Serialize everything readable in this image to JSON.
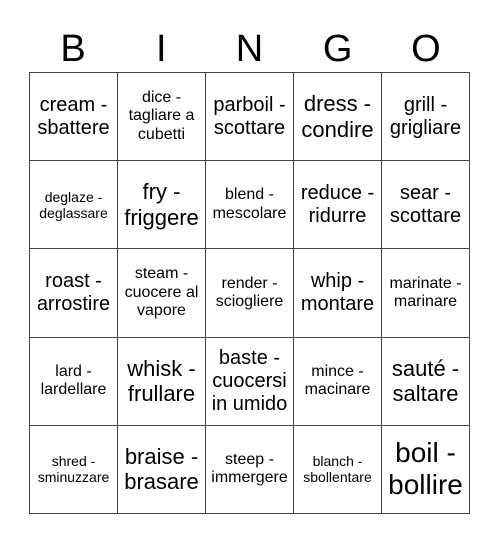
{
  "header": {
    "letters": [
      "B",
      "I",
      "N",
      "G",
      "O"
    ]
  },
  "grid": {
    "rows": [
      [
        {
          "text": "cream - sbattere",
          "size": "lg"
        },
        {
          "text": "dice - tagliare a cubetti",
          "size": "md"
        },
        {
          "text": "parboil - scottare",
          "size": "lg"
        },
        {
          "text": "dress - condire",
          "size": "xl"
        },
        {
          "text": "grill - grigliare",
          "size": "lg"
        }
      ],
      [
        {
          "text": "deglaze - deglassare",
          "size": "sm"
        },
        {
          "text": "fry - friggere",
          "size": "xl"
        },
        {
          "text": "blend - mescolare",
          "size": "md"
        },
        {
          "text": "reduce - ridurre",
          "size": "lg"
        },
        {
          "text": "sear - scottare",
          "size": "lg"
        }
      ],
      [
        {
          "text": "roast - arrostire",
          "size": "lg"
        },
        {
          "text": "steam - cuocere al vapore",
          "size": "md"
        },
        {
          "text": "render - sciogliere",
          "size": "md"
        },
        {
          "text": "whip - montare",
          "size": "lg"
        },
        {
          "text": "marinate - marinare",
          "size": "md"
        }
      ],
      [
        {
          "text": "lard - lardellare",
          "size": "md"
        },
        {
          "text": "whisk - frullare",
          "size": "xl"
        },
        {
          "text": "baste - cuocersi in umido",
          "size": "lg"
        },
        {
          "text": "mince - macinare",
          "size": "md"
        },
        {
          "text": "sauté - saltare",
          "size": "xl"
        }
      ],
      [
        {
          "text": "shred - sminuzzare",
          "size": "sm"
        },
        {
          "text": "braise - brasare",
          "size": "xl"
        },
        {
          "text": "steep - immergere",
          "size": "md"
        },
        {
          "text": "blanch - sbollentare",
          "size": "sm"
        },
        {
          "text": "boil - bollire",
          "size": "xxl"
        }
      ]
    ]
  }
}
